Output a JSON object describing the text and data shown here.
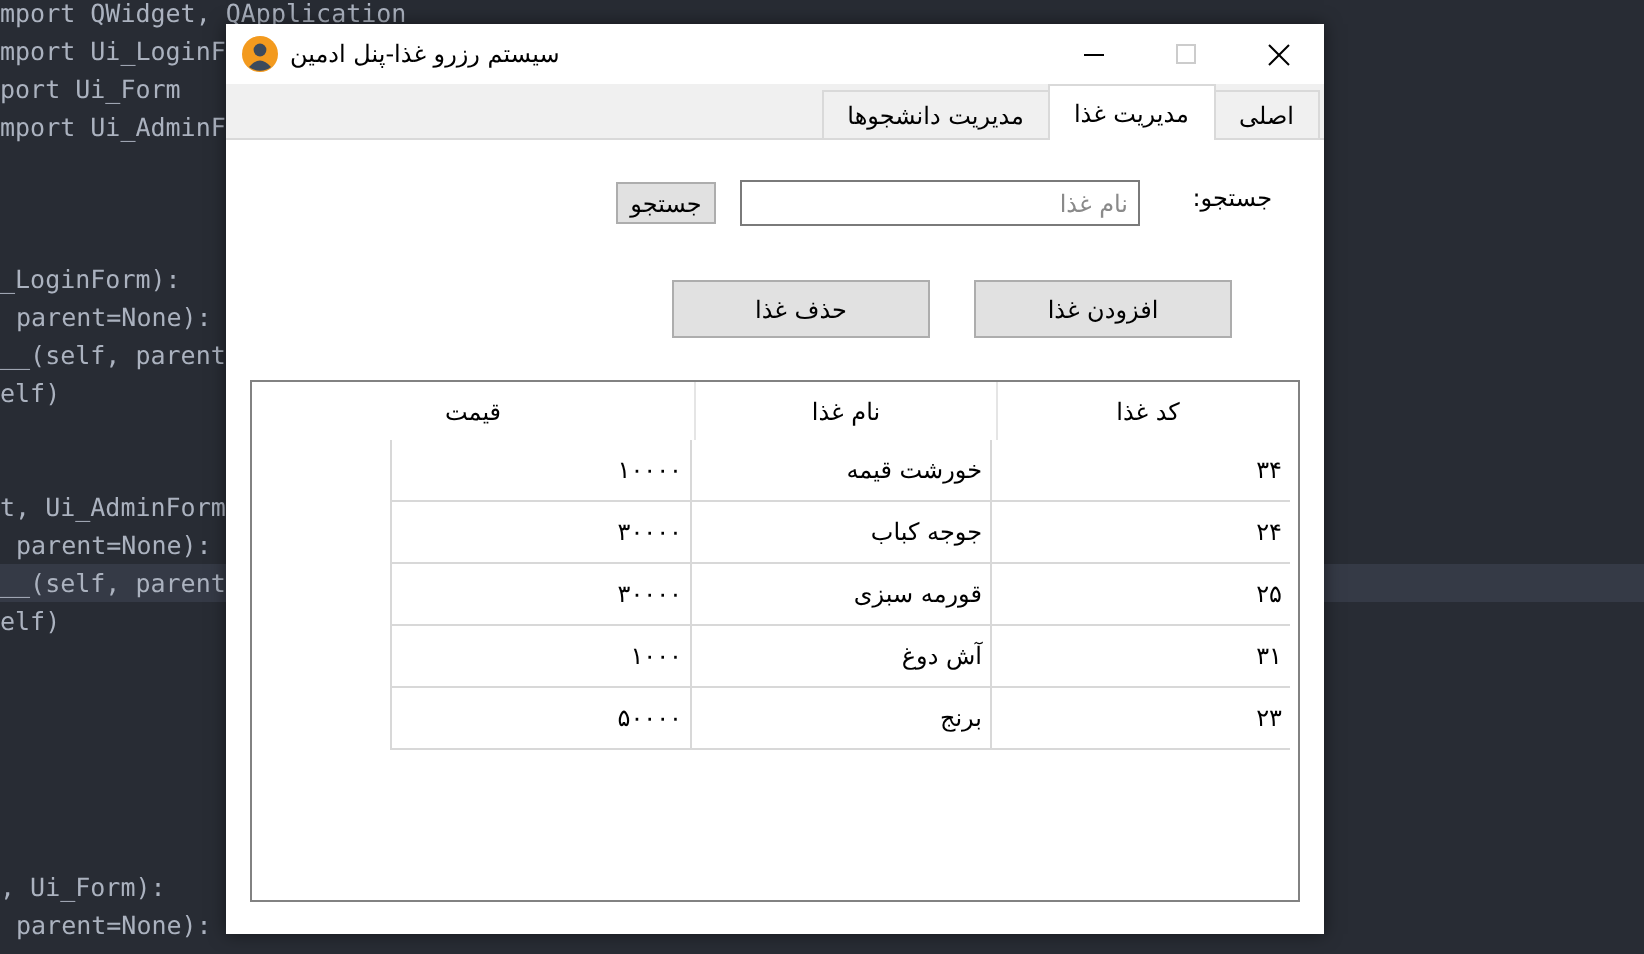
{
  "editor": {
    "groups": [
      [
        {
          "current": false,
          "text": "mport QWidget, QApplication"
        },
        {
          "current": false,
          "text": "mport Ui_LoginF"
        },
        {
          "current": false,
          "text": "port Ui_Form"
        },
        {
          "current": false,
          "text": "mport Ui_AdminF"
        }
      ],
      [
        {
          "current": false,
          "text": "_LoginForm):"
        },
        {
          "current": false,
          "text": "parent=None):"
        },
        {
          "current": false,
          "text": "__(self, parent"
        },
        {
          "current": false,
          "text": "elf)"
        }
      ],
      [
        {
          "current": false,
          "text": "t, Ui_AdminForm"
        },
        {
          "current": false,
          "text": "parent=None):"
        },
        {
          "current": true,
          "text": "__(self, parent"
        },
        {
          "current": false,
          "text": "elf)"
        }
      ],
      [
        {
          "current": false,
          "text": ", Ui_Form):"
        },
        {
          "current": false,
          "text": "parent=None):"
        }
      ]
    ]
  },
  "window": {
    "title": "سیستم رزرو غذا-پنل ادمین",
    "maximize_enabled": false,
    "tabs": [
      {
        "label": "اصلی",
        "selected": false
      },
      {
        "label": "مدیریت غذا",
        "selected": true
      },
      {
        "label": "مدیریت دانشجوها",
        "selected": false
      }
    ],
    "search": {
      "label": "جستجو:",
      "placeholder": "نام غذا",
      "button": "جستجو"
    },
    "buttons": [
      "افزودن غذا",
      "حذف غذا"
    ],
    "table": {
      "columns": [
        "کد غذا",
        "نام غذا",
        "قیمت"
      ],
      "rows": [
        [
          "۳۴",
          "خورشت قیمه",
          "۱۰۰۰۰"
        ],
        [
          "۲۴",
          "جوجه کباب",
          "۳۰۰۰۰"
        ],
        [
          "۲۵",
          "قورمه سبزی",
          "۳۰۰۰۰"
        ],
        [
          "۳۱",
          "آش دوغ",
          "۱۰۰۰"
        ],
        [
          "۲۳",
          "برنج",
          "۵۰۰۰۰"
        ]
      ]
    }
  }
}
